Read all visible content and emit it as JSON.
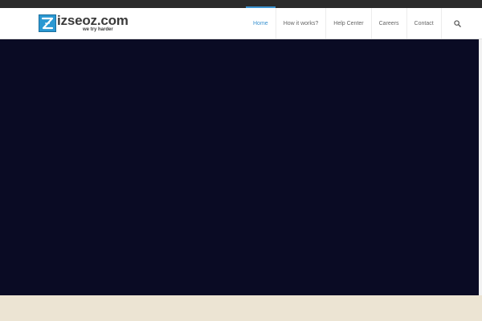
{
  "brand": {
    "logo_letter": "Z",
    "name": "izseoz.com",
    "tagline": "we try harder",
    "logo_color": "#2a98d2"
  },
  "nav": {
    "items": [
      {
        "label": "Home",
        "active": true
      },
      {
        "label": "How it works?",
        "active": false
      },
      {
        "label": "Help Center",
        "active": false
      },
      {
        "label": "Careers",
        "active": false
      },
      {
        "label": "Contact",
        "active": false
      }
    ],
    "search_icon": "search-icon",
    "accent_color": "#3b93d0"
  },
  "hero": {
    "background": "#0a0b24"
  },
  "footer_band": {
    "background": "#ece4d3"
  }
}
